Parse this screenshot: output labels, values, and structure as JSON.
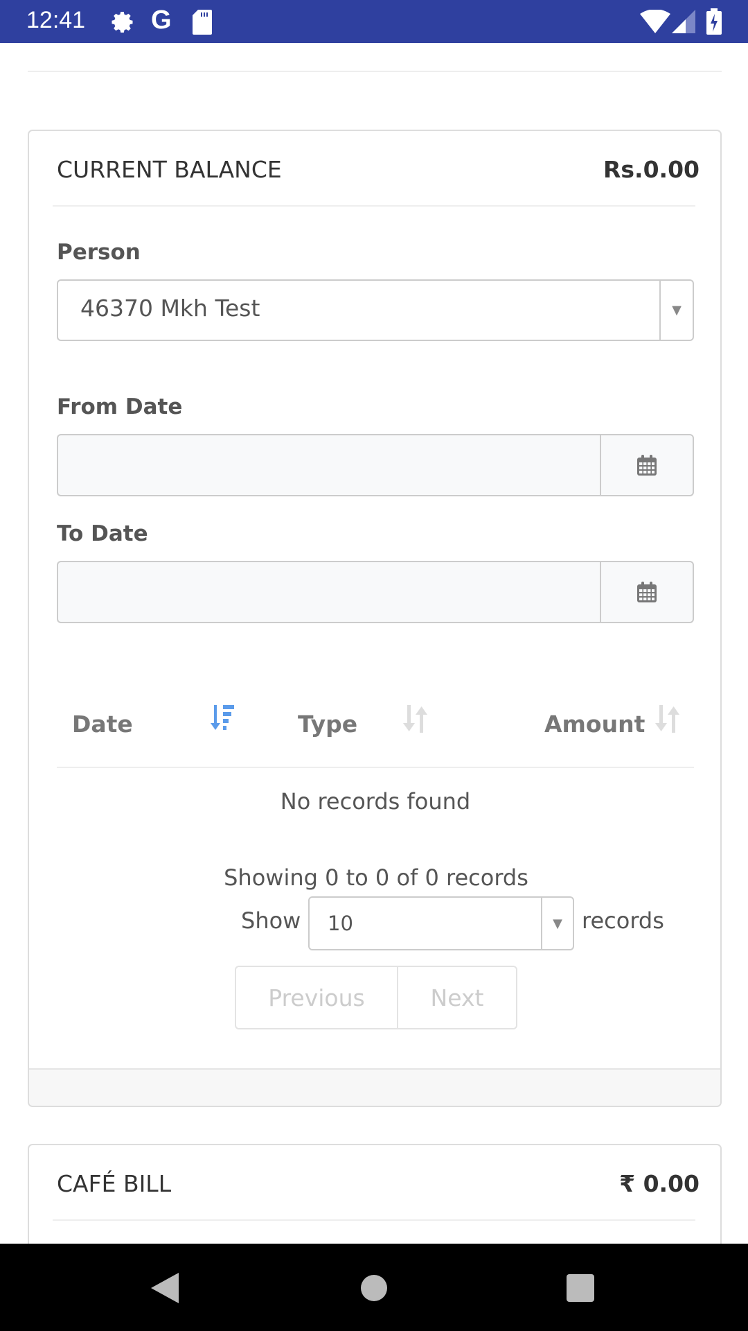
{
  "status_bar": {
    "time": "12:41",
    "icons": [
      "gear-icon",
      "google-icon",
      "sd-card-icon",
      "wifi-icon",
      "signal-icon",
      "battery-charging-icon"
    ],
    "color": "#2f409f"
  },
  "balance_card": {
    "title": "CURRENT BALANCE",
    "amount": "Rs.0.00",
    "person": {
      "label": "Person",
      "value": "46370 Mkh Test"
    },
    "from_date": {
      "label": "From Date",
      "value": ""
    },
    "to_date": {
      "label": "To Date",
      "value": ""
    },
    "table": {
      "columns": [
        {
          "label": "Date",
          "sort": "descending"
        },
        {
          "label": "Type",
          "sort": "none"
        },
        {
          "label": "Amount",
          "sort": "none"
        }
      ],
      "empty_text": "No records found"
    },
    "pagination": {
      "info": "Showing 0 to 0 of 0 records",
      "show_label": "Show",
      "page_size": "10",
      "records_label": "records",
      "previous": "Previous",
      "next": "Next"
    }
  },
  "cafe_card": {
    "title": "CAFÉ BILL",
    "amount": "₹ 0.00"
  },
  "accent_color": "#5b9bea"
}
